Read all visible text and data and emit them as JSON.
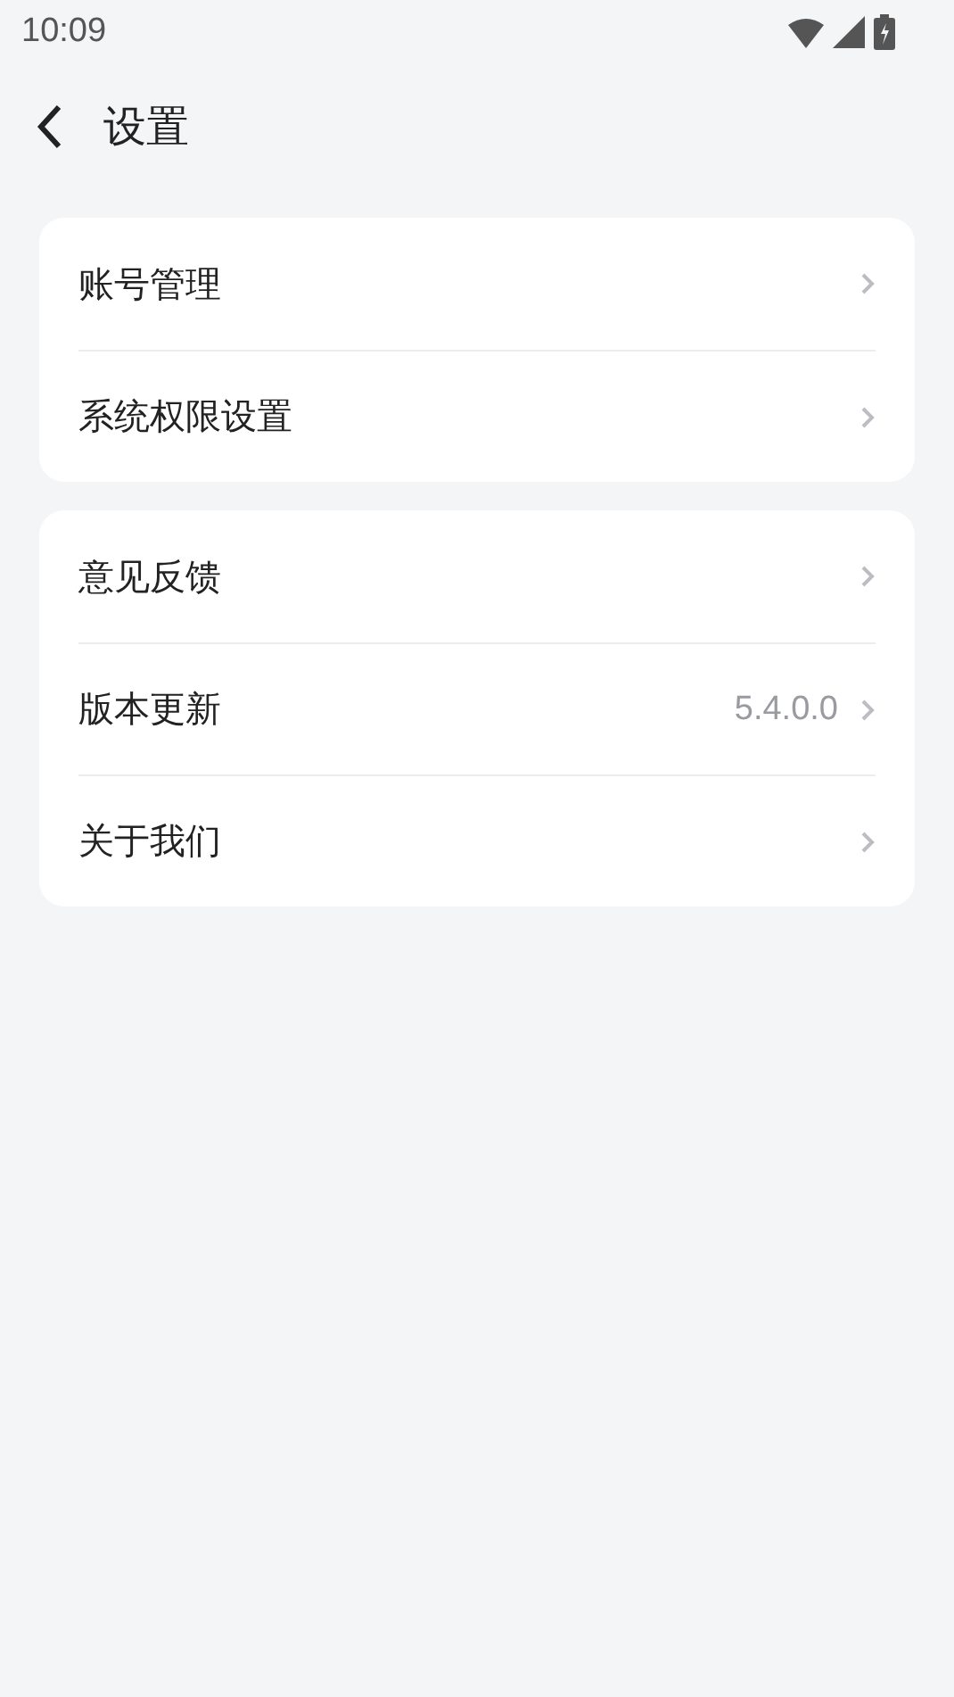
{
  "status_bar": {
    "time": "10:09"
  },
  "header": {
    "title": "设置"
  },
  "groups": [
    {
      "items": [
        {
          "label": "账号管理"
        },
        {
          "label": "系统权限设置"
        }
      ]
    },
    {
      "items": [
        {
          "label": "意见反馈"
        },
        {
          "label": "版本更新",
          "value": "5.4.0.0"
        },
        {
          "label": "关于我们"
        }
      ]
    }
  ]
}
